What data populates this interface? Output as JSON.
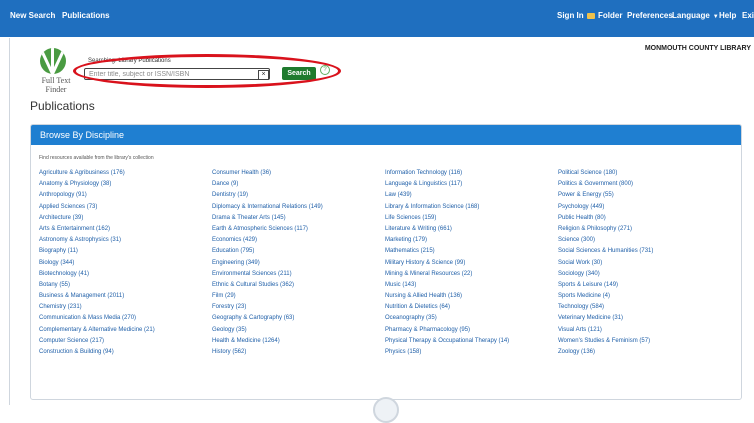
{
  "topbar": {
    "new_search": "New Search",
    "publications": "Publications",
    "sign_in": "Sign In",
    "folder": "Folder",
    "preferences": "Preferences",
    "language": "Language",
    "help": "Help",
    "exit": "Exit"
  },
  "logo": {
    "line1": "Full Text",
    "line2": "Finder"
  },
  "search": {
    "label": "Searching: Library Publications",
    "placeholder": "Enter title, subject or ISSN/ISBN",
    "clear": "×",
    "button": "Search",
    "help": "?"
  },
  "library": {
    "name": "MONMOUTH COUNTY LIBRARY"
  },
  "page": {
    "title": "Publications"
  },
  "browse": {
    "header": "Browse By Discipline",
    "intro": "Find resources available from the library's collection",
    "columns": [
      [
        "Agriculture & Agribusiness (176)",
        "Anatomy & Physiology (38)",
        "Anthropology (91)",
        "Applied Sciences (73)",
        "Architecture (39)",
        "Arts & Entertainment (162)",
        "Astronomy & Astrophysics (31)",
        "Biography (11)",
        "Biology (344)",
        "Biotechnology (41)",
        "Botany (55)",
        "Business & Management (2011)",
        "Chemistry (231)",
        "Communication & Mass Media (270)",
        "Complementary & Alternative Medicine (21)",
        "Computer Science (217)",
        "Construction & Building (94)"
      ],
      [
        "Consumer Health (36)",
        "Dance (9)",
        "Dentistry (19)",
        "Diplomacy & International Relations (149)",
        "Drama & Theater Arts (145)",
        "Earth & Atmospheric Sciences (117)",
        "Economics (429)",
        "Education (795)",
        "Engineering (349)",
        "Environmental Sciences (211)",
        "Ethnic & Cultural Studies (362)",
        "Film (29)",
        "Forestry (23)",
        "Geography & Cartography (63)",
        "Geology (35)",
        "Health & Medicine (1264)",
        "History (562)"
      ],
      [
        "Information Technology (116)",
        "Language & Linguistics (117)",
        "Law (439)",
        "Library & Information Science (168)",
        "Life Sciences (159)",
        "Literature & Writing (661)",
        "Marketing (179)",
        "Mathematics (215)",
        "Military History & Science (99)",
        "Mining & Mineral Resources (22)",
        "Music (143)",
        "Nursing & Allied Health (136)",
        "Nutrition & Dietetics (64)",
        "Oceanography (35)",
        "Pharmacy & Pharmacology (95)",
        "Physical Therapy & Occupational Therapy (14)",
        "Physics (158)"
      ],
      [
        "Political Science (180)",
        "Politics & Government (800)",
        "Power & Energy (55)",
        "Psychology (449)",
        "Public Health (80)",
        "Religion & Philosophy (271)",
        "Science (300)",
        "Social Sciences & Humanities (731)",
        "Social Work (30)",
        "Sociology (340)",
        "Sports & Leisure (149)",
        "Sports Medicine (4)",
        "Technology (584)",
        "Veterinary Medicine (31)",
        "Visual Arts (121)",
        "Women's Studies & Feminism (57)",
        "Zoology (136)"
      ]
    ]
  }
}
